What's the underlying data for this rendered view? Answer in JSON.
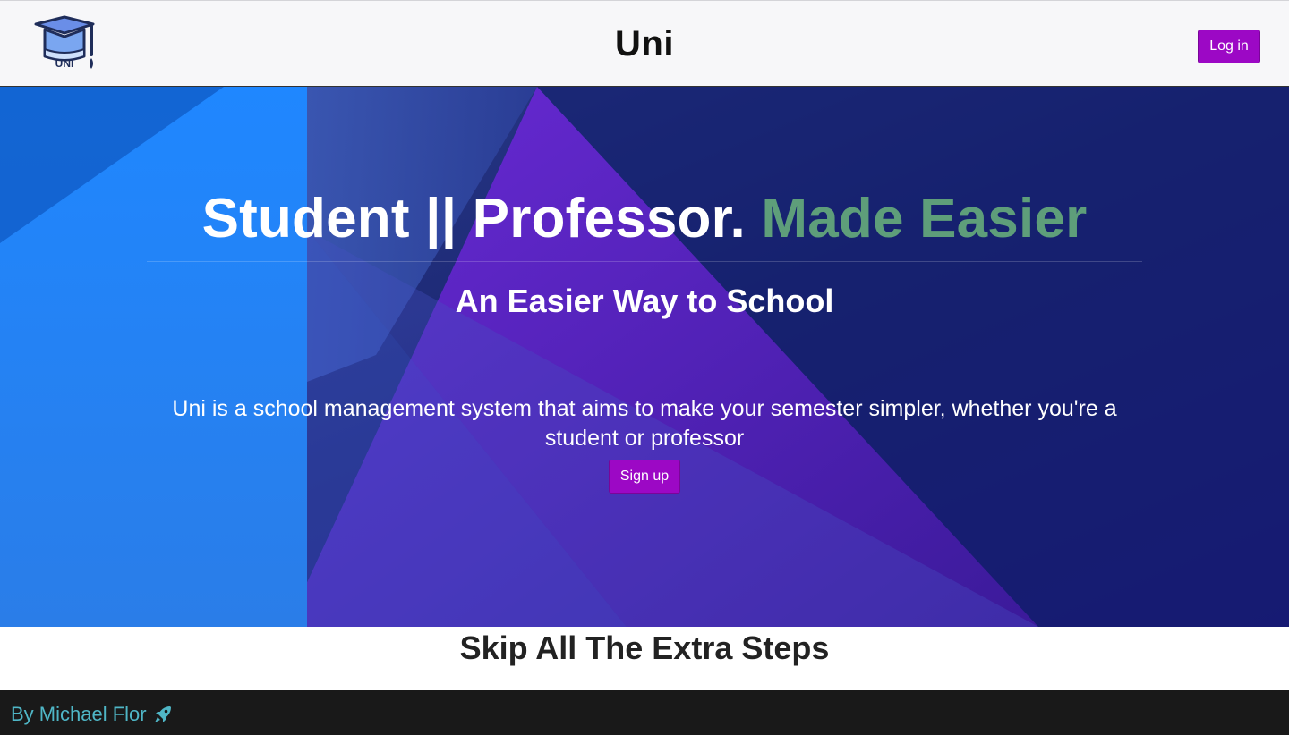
{
  "navbar": {
    "logo_icon": "graduation-cap-icon",
    "logo_text": "UNI",
    "brand": "Uni",
    "login_label": "Log in"
  },
  "hero": {
    "title_main": "Student || Professor.",
    "title_accent": "Made Easier",
    "subtitle": "An Easier Way to School",
    "description": "Uni is a school management system that aims to make your semester simpler, whether you're a student or professor",
    "signup_label": "Sign up"
  },
  "section": {
    "heading": "Skip All The Extra Steps"
  },
  "footer": {
    "text": "By Michael Flor",
    "icon": "rocket-icon"
  },
  "colors": {
    "button": "#9c08c5",
    "accent_text": "#5e9e7a",
    "footer_text": "#4fb6c6",
    "footer_bg": "#191919"
  }
}
